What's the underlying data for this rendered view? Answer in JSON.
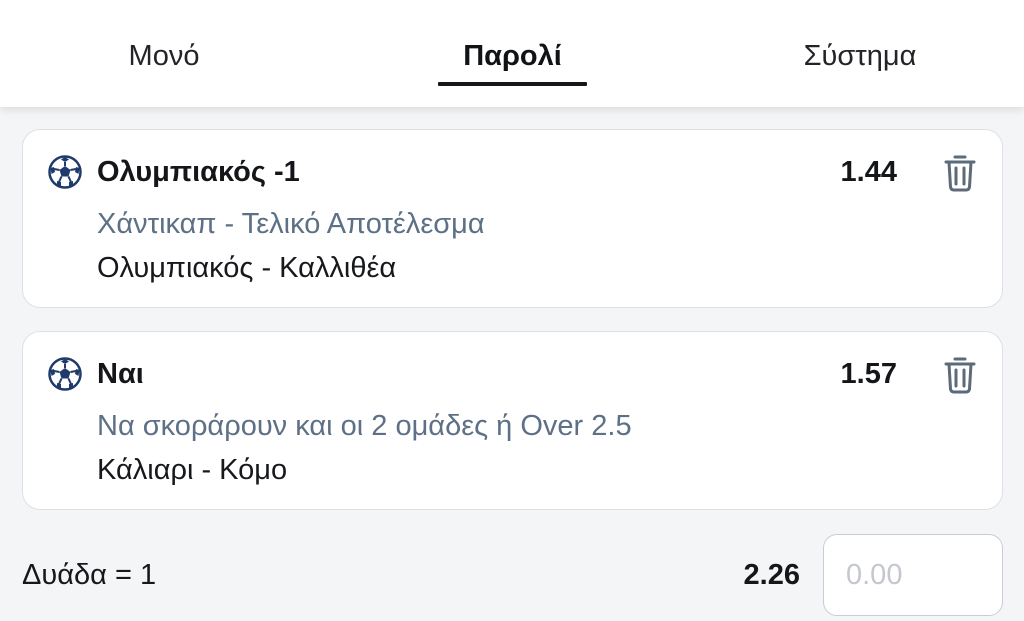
{
  "tabs": [
    {
      "label": "Μονό",
      "active": false
    },
    {
      "label": "Παρολί",
      "active": true
    },
    {
      "label": "Σύστημα",
      "active": false
    }
  ],
  "selections": [
    {
      "pick": "Ολυμπιακός -1",
      "odds": "1.44",
      "market": "Χάντικαπ - Τελικό Αποτέλεσμα",
      "event": "Ολυμπιακός - Καλλιθέα",
      "sport_icon": "soccer-ball-icon",
      "delete_icon": "trash-icon"
    },
    {
      "pick": "Ναι",
      "odds": "1.57",
      "market": "Να σκοράρουν και οι 2 ομάδες ή Over 2.5",
      "event": "Κάλιαρι - Κόμο",
      "sport_icon": "soccer-ball-icon",
      "delete_icon": "trash-icon"
    }
  ],
  "combination": {
    "label": "Δυάδα = 1",
    "odds": "2.26",
    "stake_value": "",
    "stake_placeholder": "0.00"
  },
  "colors": {
    "ball": "#1f3a6b",
    "market_text": "#5d7086",
    "trash": "#5d6a7a",
    "active_underline": "#15171b"
  }
}
